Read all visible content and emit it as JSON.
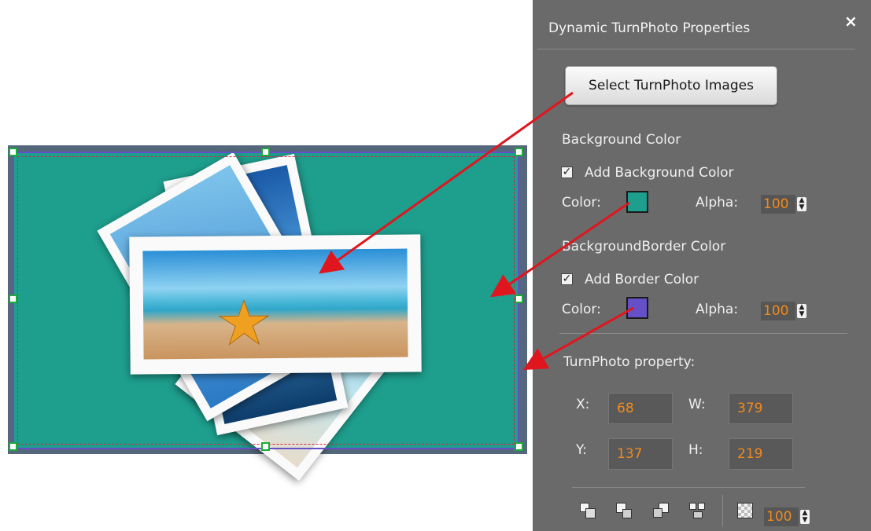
{
  "panel": {
    "title": "Dynamic TurnPhoto Properties",
    "close_glyph": "×",
    "select_button_label": "Select TurnPhoto Images",
    "background_section": {
      "heading": "Background Color",
      "checkbox_label": "Add Background Color",
      "checked": true,
      "color_label": "Color:",
      "color": "#1e9e8d",
      "alpha_label": "Alpha:",
      "alpha_value": "100"
    },
    "border_section": {
      "heading": "BackgroundBorder Color",
      "checkbox_label": "Add Border Color",
      "checked": true,
      "color_label": "Color:",
      "color": "#6650c8",
      "alpha_label": "Alpha:",
      "alpha_value": "100"
    },
    "turnphoto": {
      "heading": "TurnPhoto property:",
      "x_label": "X:",
      "x_value": "68",
      "w_label": "W:",
      "w_value": "379",
      "y_label": "Y:",
      "y_value": "137",
      "h_label": "H:",
      "h_value": "219"
    },
    "toolbar": {
      "icons": [
        "bring-to-front-icon",
        "bring-forward-icon",
        "send-backward-icon",
        "send-to-back-icon",
        "transparency-icon"
      ],
      "opacity_value": "100"
    }
  },
  "colors": {
    "panel_bg": "#6a6a6a",
    "value_text": "#f08a1c",
    "arrow": "#e0161e",
    "selection_handle": "#1caa3a"
  }
}
